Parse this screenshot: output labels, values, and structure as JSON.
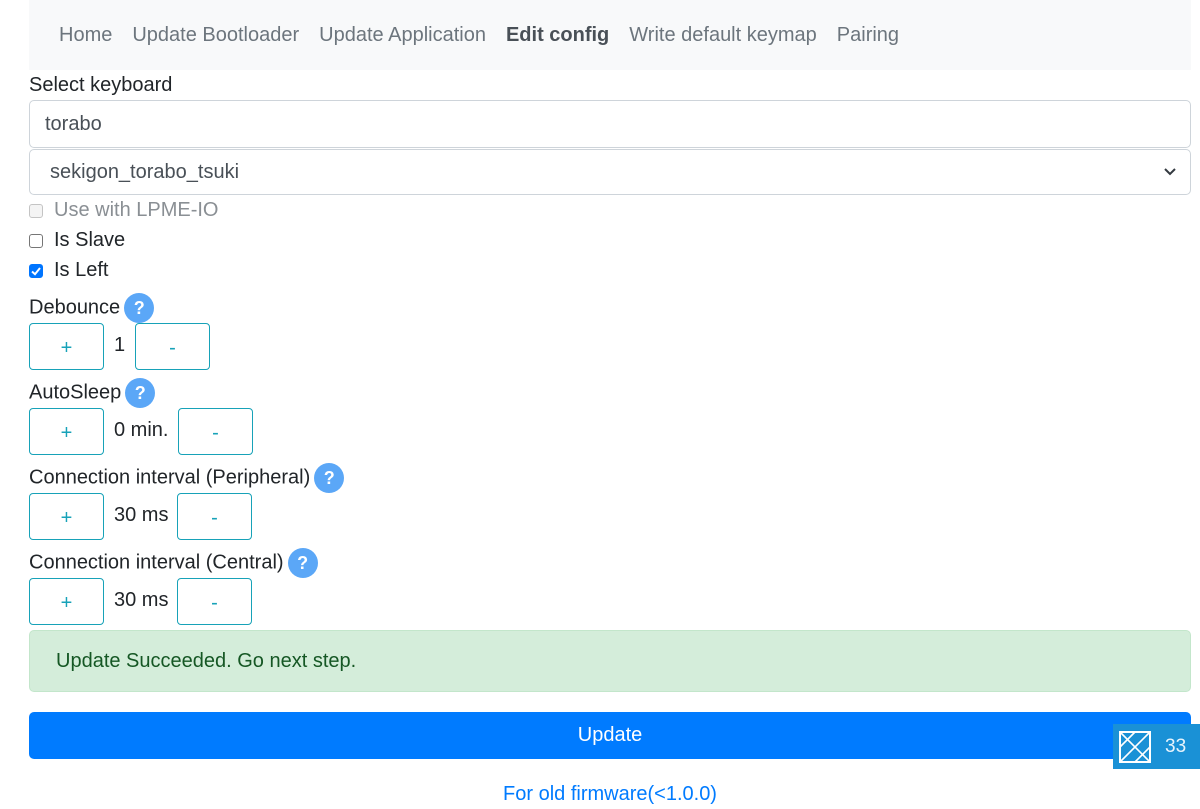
{
  "nav": {
    "items": [
      {
        "label": "Home",
        "active": false
      },
      {
        "label": "Update Bootloader",
        "active": false
      },
      {
        "label": "Update Application",
        "active": false
      },
      {
        "label": "Edit config",
        "active": true
      },
      {
        "label": "Write default keymap",
        "active": false
      },
      {
        "label": "Pairing",
        "active": false
      }
    ]
  },
  "keyboard": {
    "label": "Select keyboard",
    "search_value": "torabo",
    "selected": "sekigon_torabo_tsuki"
  },
  "options": {
    "lpme": {
      "label": "Use with LPME-IO",
      "checked": false,
      "disabled": true
    },
    "slave": {
      "label": "Is Slave",
      "checked": false
    },
    "left": {
      "label": "Is Left",
      "checked": true
    }
  },
  "settings": {
    "debounce": {
      "label": "Debounce",
      "value": "1"
    },
    "autosleep": {
      "label": "AutoSleep",
      "value": "0 min."
    },
    "peripheral": {
      "label": "Connection interval (Peripheral)",
      "value": "30 ms"
    },
    "central": {
      "label": "Connection interval (Central)",
      "value": "30 ms"
    }
  },
  "common": {
    "plus": "+",
    "minus": "-",
    "help": "?"
  },
  "alert": {
    "text": "Update Succeeded. Go next step."
  },
  "actions": {
    "update": "Update",
    "old_firmware": "For old firmware(<1.0.0)"
  },
  "widget": {
    "count": "33"
  },
  "colors": {
    "primary": "#007bff",
    "info": "#17a2b8",
    "success_bg": "#d4edda",
    "help": "#5ba7f7"
  }
}
